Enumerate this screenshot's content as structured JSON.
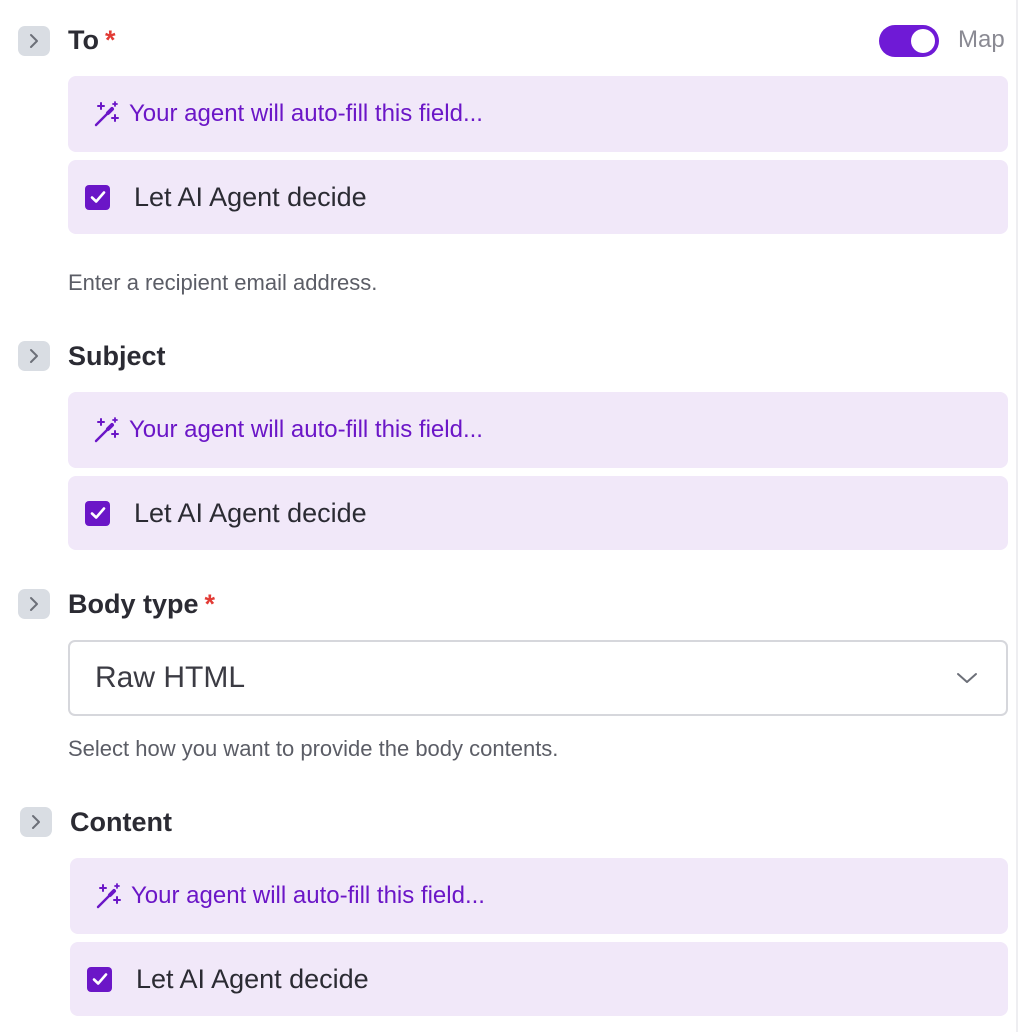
{
  "fields": {
    "to": {
      "label": "To",
      "required_mark": "*",
      "map_toggle": {
        "label": "Map",
        "on": true
      },
      "autofill_text": "Your agent will auto-fill this field...",
      "ai_decide": {
        "label": "Let AI Agent decide",
        "checked": true
      },
      "help": "Enter a recipient email address."
    },
    "subject": {
      "label": "Subject",
      "autofill_text": "Your agent will auto-fill this field...",
      "ai_decide": {
        "label": "Let AI Agent decide",
        "checked": true
      }
    },
    "body_type": {
      "label": "Body type",
      "required_mark": "*",
      "selected": "Raw HTML",
      "help": "Select how you want to provide the body contents."
    },
    "content": {
      "label": "Content",
      "autofill_text": "Your agent will auto-fill this field...",
      "ai_decide": {
        "label": "Let AI Agent decide",
        "checked": true
      }
    }
  },
  "icons": {
    "expand": "chevron-right-icon",
    "autofill": "magic-wand-icon",
    "check": "checkmark-icon",
    "dropdown": "chevron-down-icon"
  },
  "colors": {
    "accent": "#6b16c7",
    "toggle_on": "#6f1ad6",
    "autofill_bg": "#f1e8f9",
    "required": "#e23b35",
    "muted_text": "#5b5d66"
  }
}
